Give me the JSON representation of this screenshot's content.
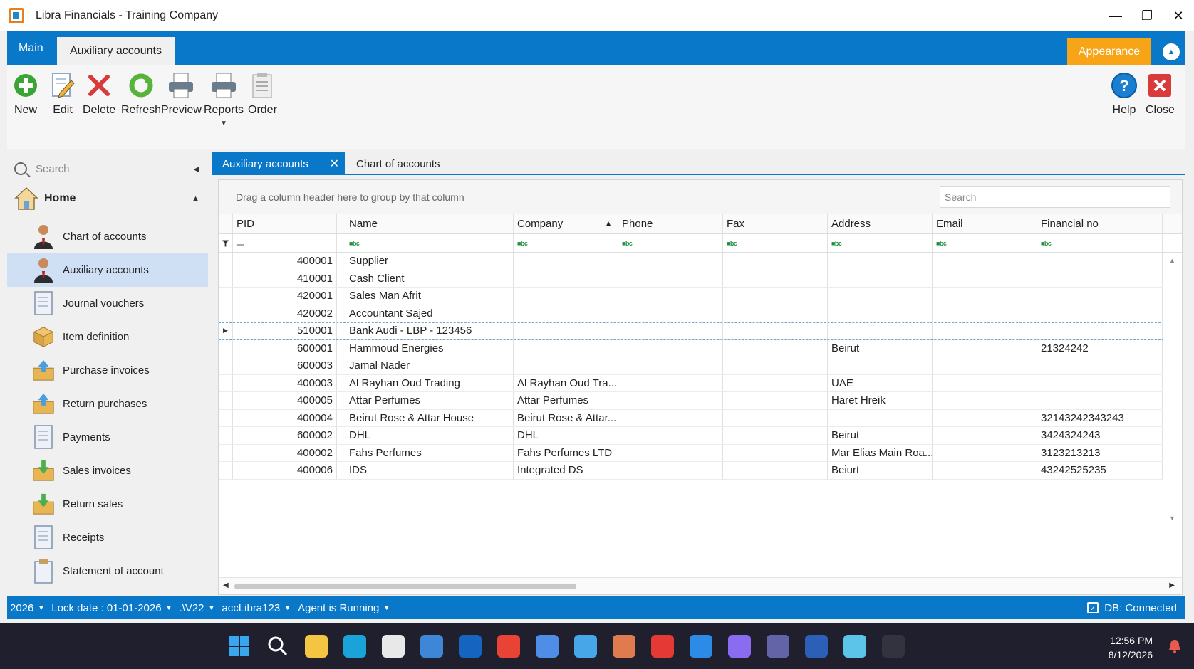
{
  "window": {
    "title": "Libra Financials - Training Company",
    "controls": [
      "minimize",
      "restore",
      "close"
    ]
  },
  "ribbon": {
    "tabs": [
      {
        "label": "Main"
      },
      {
        "label": "Auxiliary accounts"
      }
    ],
    "appearance_label": "Appearance",
    "buttons": [
      {
        "label": "New",
        "icon": "add-icon",
        "color": "#3aa535"
      },
      {
        "label": "Edit",
        "icon": "edit-icon",
        "color": "#4b8ec9"
      },
      {
        "label": "Delete",
        "icon": "delete-icon",
        "color": "#d93a3a"
      },
      {
        "label": "Refresh",
        "icon": "refresh-icon",
        "color": "#57b33a"
      },
      {
        "label": "Preview",
        "icon": "preview-icon",
        "color": "#6a7d8f"
      },
      {
        "label": "Reports",
        "icon": "printer-icon",
        "color": "#6a7d8f"
      },
      {
        "label": "Order",
        "icon": "order-icon",
        "color": "#8b8b8b"
      }
    ],
    "right_buttons": [
      {
        "label": "Help",
        "icon": "help-icon",
        "color": "#1b7fd1"
      },
      {
        "label": "Close",
        "icon": "close-icon",
        "color": "#d93a3a"
      }
    ]
  },
  "nav": {
    "search_placeholder": "Search",
    "home_label": "Home",
    "items": [
      {
        "label": "Chart of accounts",
        "icon": "user-icon"
      },
      {
        "label": "Auxiliary accounts",
        "icon": "user-icon",
        "selected": true
      },
      {
        "label": "Journal vouchers",
        "icon": "document-icon"
      },
      {
        "label": "Item definition",
        "icon": "box-icon"
      },
      {
        "label": "Purchase invoices",
        "icon": "inbox-icon"
      },
      {
        "label": "Return purchases",
        "icon": "inbox-icon"
      },
      {
        "label": "Payments",
        "icon": "document-icon"
      },
      {
        "label": "Sales invoices",
        "icon": "inbox-icon"
      },
      {
        "label": "Return sales",
        "icon": "inbox-icon"
      },
      {
        "label": "Receipts",
        "icon": "document-icon"
      },
      {
        "label": "Statement of account",
        "icon": "clipboard-icon"
      }
    ]
  },
  "doc_tabs": [
    {
      "label": "Auxiliary accounts",
      "active": true
    },
    {
      "label": "Chart of accounts"
    }
  ],
  "grid": {
    "group_hint": "Drag a column header here to group by that column",
    "search_placeholder": "Search",
    "columns": [
      "PID",
      "Name",
      "Company",
      "Phone",
      "Fax",
      "Address",
      "Email",
      "Financial no"
    ],
    "sorted_column": "Company",
    "rows": [
      [
        "400001",
        "Supplier",
        "",
        "",
        "",
        "",
        "",
        ""
      ],
      [
        "410001",
        "Cash Client",
        "",
        "",
        "",
        "",
        "",
        ""
      ],
      [
        "420001",
        "Sales Man Afrit",
        "",
        "",
        "",
        "",
        "",
        ""
      ],
      [
        "420002",
        "Accountant  Sajed",
        "",
        "",
        "",
        "",
        "",
        ""
      ],
      [
        "510001",
        "Bank Audi - LBP - 123456",
        "",
        "",
        "",
        "",
        "",
        ""
      ],
      [
        "600001",
        "Hammoud Energies",
        "",
        "",
        "",
        "Beirut",
        "",
        "21324242"
      ],
      [
        "600003",
        "Jamal Nader",
        "",
        "",
        "",
        "",
        "",
        ""
      ],
      [
        "400003",
        "Al Rayhan Oud Trading",
        "Al Rayhan Oud Tra...",
        "",
        "",
        "UAE",
        "",
        ""
      ],
      [
        "400005",
        "Attar Perfumes",
        "Attar Perfumes",
        "",
        "",
        "Haret Hreik",
        "",
        ""
      ],
      [
        "400004",
        "Beirut Rose & Attar House",
        "Beirut Rose & Attar...",
        "",
        "",
        "",
        "",
        "32143242343243"
      ],
      [
        "600002",
        "DHL",
        "DHL",
        "",
        "",
        "Beirut",
        "",
        "3424324243"
      ],
      [
        "400002",
        "Fahs Perfumes",
        "Fahs Perfumes LTD",
        "",
        "",
        "Mar Elias Main Roa...",
        "",
        "3123213213"
      ],
      [
        "400006",
        "IDS",
        "Integrated DS",
        "",
        "",
        "Beiurt",
        "",
        "43242525235"
      ]
    ],
    "focused_row": 4
  },
  "status": {
    "items": [
      "2026",
      "Lock date : 01-01-2026",
      ".\\V22",
      "accLibra123",
      "Agent is Running"
    ],
    "db_label": "DB: Connected"
  },
  "taskbar": {
    "time": "12:56 PM",
    "date": "8/12/2026",
    "apps": [
      {
        "name": "start-icon",
        "color": "#38a7f0"
      },
      {
        "name": "search-icon",
        "color": "#ffffff"
      },
      {
        "name": "file-explorer-icon",
        "color": "#f4c542"
      },
      {
        "name": "edge-icon",
        "color": "#1aa3d9"
      },
      {
        "name": "store-icon",
        "color": "#e8e8e8"
      },
      {
        "name": "outlook-new-icon",
        "color": "#3e87d6"
      },
      {
        "name": "outlook-icon",
        "color": "#1565c0"
      },
      {
        "name": "chrome-icon",
        "color": "#e84335"
      },
      {
        "name": "app-blue-icon",
        "color": "#4f8ee6"
      },
      {
        "name": "photos-icon",
        "color": "#47a6e8"
      },
      {
        "name": "claude-icon",
        "color": "#e07a4f"
      },
      {
        "name": "anydesk-icon",
        "color": "#e53935"
      },
      {
        "name": "vscode-icon",
        "color": "#2b8be6"
      },
      {
        "name": "app-purple-icon",
        "color": "#8a6cf0"
      },
      {
        "name": "teams-icon",
        "color": "#6264a7"
      },
      {
        "name": "word-icon",
        "color": "#2b5fb8"
      },
      {
        "name": "notepad-icon",
        "color": "#5cc4e8"
      },
      {
        "name": "libra-app-icon",
        "color": "#333340"
      }
    ]
  }
}
